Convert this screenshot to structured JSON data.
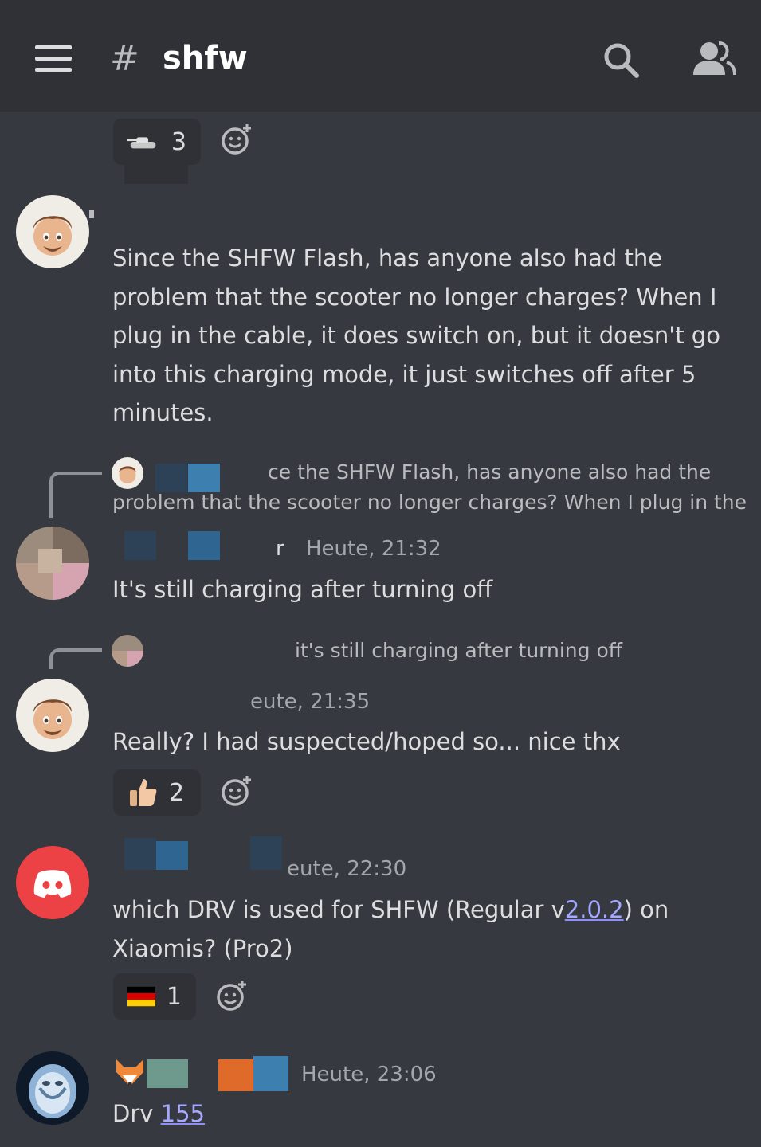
{
  "header": {
    "hash": "#",
    "channel": "shfw"
  },
  "top_reaction": {
    "emoji": "tank",
    "count": "3"
  },
  "messages": [
    {
      "text": "Since the SHFW Flash, has anyone also had the problem that the scooter no longer charges? When I plug in the cable, it does switch on, but it doesn't go into this charging mode, it just switches off after 5 minutes."
    },
    {
      "reply_line1": "ce the SHFW Flash, has anyone also had the",
      "reply_line2": "problem that the scooter no longer charges? When I plug in the",
      "author_tail": "r",
      "timestamp": "Heute, 21:32",
      "text": "It's still charging after turning off"
    },
    {
      "reply_line1": "it's still charging after turning off",
      "timestamp": "eute, 21:35",
      "text": "Really? I had suspected/hoped so... nice thx",
      "reaction": {
        "emoji": "thumbs-up",
        "count": "2"
      }
    },
    {
      "timestamp": "eute, 22:30",
      "text_before": "which DRV is used for SHFW (Regular v",
      "link": "2.0.2",
      "text_after": ") on",
      "text_line2": "Xiaomis? (Pro2)",
      "reaction": {
        "emoji": "flag-germany",
        "count": "1"
      }
    },
    {
      "timestamp": "Heute, 23:06",
      "text_before": "Drv ",
      "link": "155"
    }
  ],
  "colors": {
    "background": "#36393f",
    "header": "#2f3136",
    "text": "#dcddde",
    "muted": "#a3a6aa",
    "link": "#a6a8ff",
    "discord_red": "#ed4245"
  }
}
